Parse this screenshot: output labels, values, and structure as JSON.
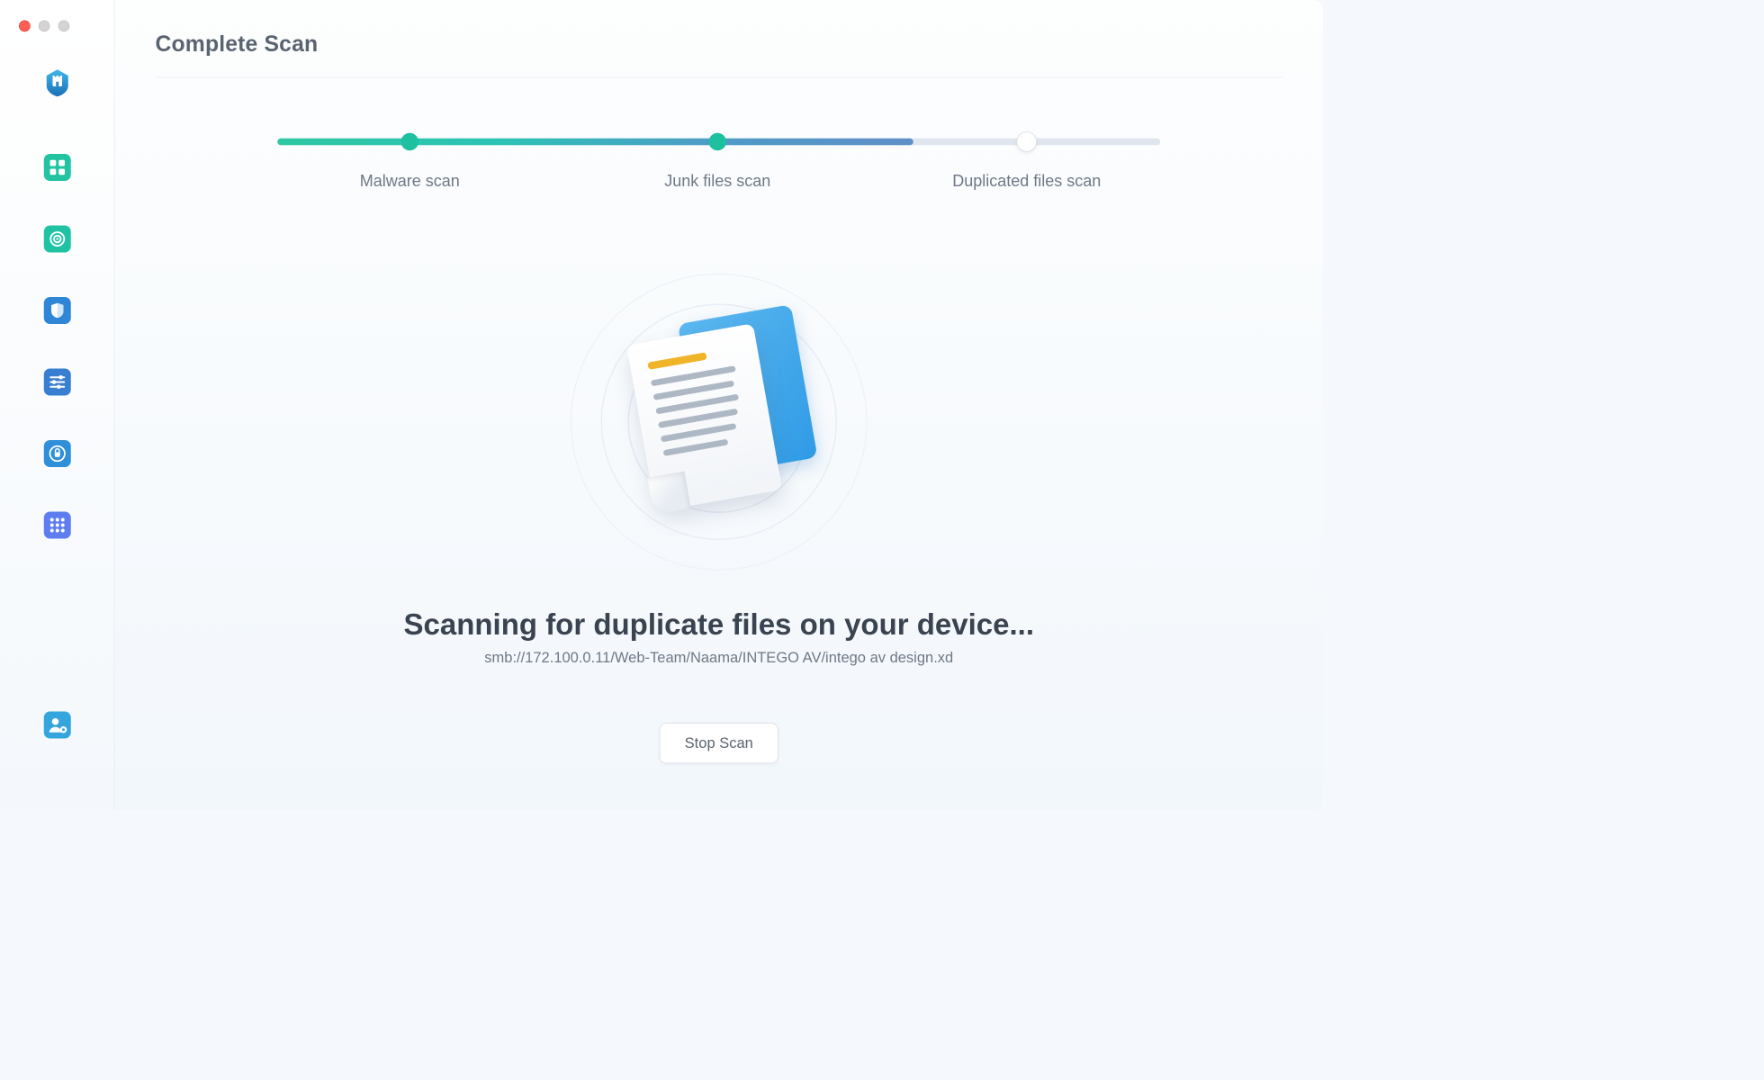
{
  "window": {
    "title": "Complete Scan"
  },
  "sidebar": {
    "items": [
      {
        "id": "logo",
        "name": "app-logo",
        "interactable": false
      },
      {
        "id": "dash",
        "name": "dashboard",
        "interactable": true
      },
      {
        "id": "scan",
        "name": "scan",
        "interactable": true,
        "active": true
      },
      {
        "id": "protect",
        "name": "protection",
        "interactable": true
      },
      {
        "id": "tune",
        "name": "system-tune",
        "interactable": true
      },
      {
        "id": "privacy",
        "name": "privacy-lock",
        "interactable": true
      },
      {
        "id": "apps",
        "name": "app-grid",
        "interactable": true
      }
    ],
    "footer": {
      "id": "account",
      "name": "account-settings",
      "interactable": true
    }
  },
  "progress": {
    "steps": [
      {
        "label": "Malware scan",
        "state": "done"
      },
      {
        "label": "Junk files scan",
        "state": "done"
      },
      {
        "label": "Duplicated files scan",
        "state": "running"
      }
    ],
    "percent": 72
  },
  "status": {
    "headline": "Scanning for duplicate files on your device...",
    "path": "smb://172.100.0.11/Web-Team/Naama/INTEGO AV/intego av design.xd"
  },
  "actions": {
    "stop_label": "Stop Scan"
  }
}
